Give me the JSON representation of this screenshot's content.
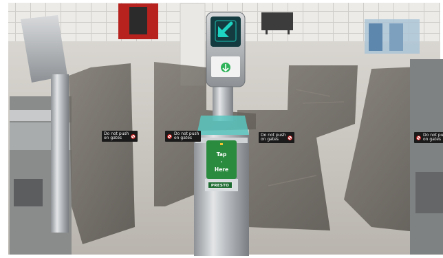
{
  "scene": {
    "subject": "subway-fare-gate",
    "signal_arrow": "diagonal-go-arrow",
    "signal_color": "#1fd3c2",
    "reader_color": "#2a8a3e"
  },
  "stickers": {
    "text_line1": "Do not push",
    "text_line2": "on gates"
  },
  "reader": {
    "tap_line1": "Tap",
    "tap_line2": "Here",
    "brand": "PRESTO"
  }
}
